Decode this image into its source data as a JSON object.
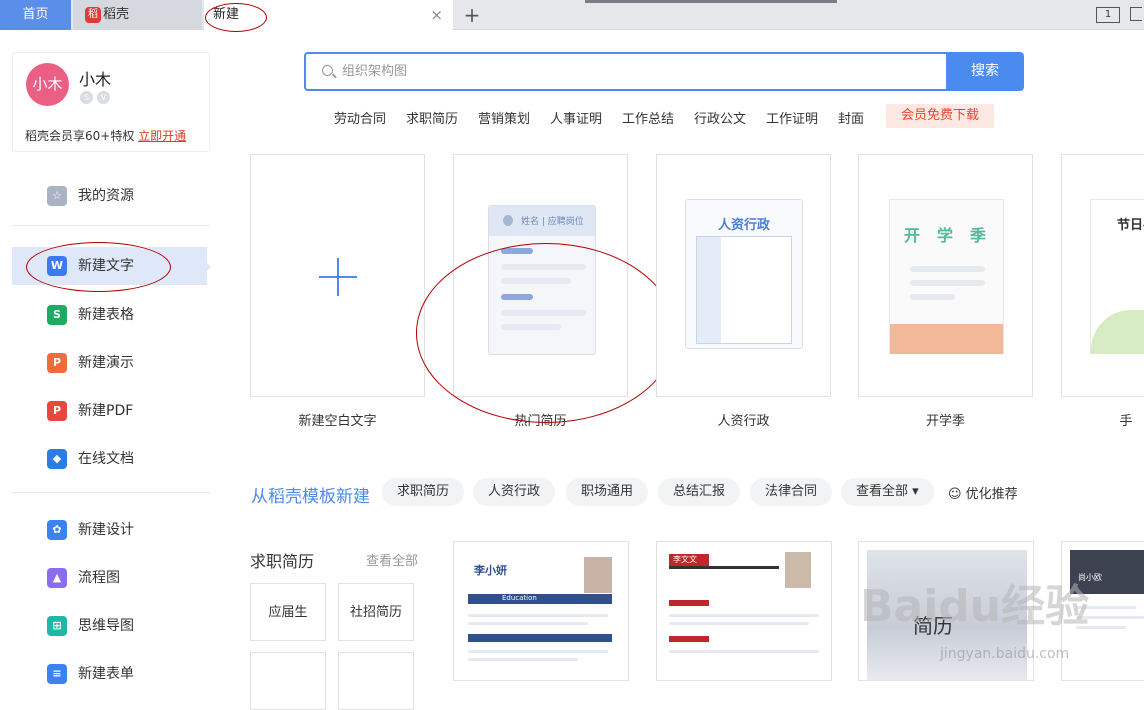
{
  "tabs": {
    "home": "首页",
    "daoke": "稻壳",
    "daoke_logo": "稻",
    "new": "新建",
    "close": "×",
    "plus": "+"
  },
  "layout_icon": "1",
  "user": {
    "avatar": "小木",
    "name": "小木",
    "vip_text": "稻壳会员享60+特权",
    "vip_link": "立即开通"
  },
  "sidebar": {
    "items": [
      {
        "label": "我的资源",
        "icon": "☆"
      },
      {
        "label": "新建文字",
        "icon": "W"
      },
      {
        "label": "新建表格",
        "icon": "S"
      },
      {
        "label": "新建演示",
        "icon": "P"
      },
      {
        "label": "新建PDF",
        "icon": "P"
      },
      {
        "label": "在线文档",
        "icon": "◆"
      },
      {
        "label": "新建设计",
        "icon": "✿"
      },
      {
        "label": "流程图",
        "icon": "▲"
      },
      {
        "label": "思维导图",
        "icon": "⊞"
      },
      {
        "label": "新建表单",
        "icon": "≡"
      }
    ]
  },
  "search": {
    "placeholder": "组织架构图",
    "button": "搜索"
  },
  "hot_tags": [
    "劳动合同",
    "求职简历",
    "营销策划",
    "人事证明",
    "工作总结",
    "行政公文",
    "工作证明",
    "封面"
  ],
  "hot_vip": "会员免费下载",
  "cards": [
    {
      "label": "新建空白文字"
    },
    {
      "label": "热门简历",
      "field": "姓名 | 应聘岗位"
    },
    {
      "label": "人资行政",
      "title": "人资行政"
    },
    {
      "label": "开学季",
      "chars": [
        "开",
        "学",
        "季"
      ]
    },
    {
      "label": "手",
      "title": "节日手"
    }
  ],
  "template_section": {
    "title": "从稻壳模板新建",
    "chips": [
      "求职简历",
      "人资行政",
      "职场通用",
      "总结汇报",
      "法律合同",
      "查看全部 ▾"
    ],
    "optimize": "☺ 优化推荐"
  },
  "category": {
    "title": "求职简历",
    "view_all": "查看全部",
    "subs": [
      "应届生",
      "社招简历"
    ]
  },
  "templates": [
    {
      "name": "李小妍",
      "tag": "Education"
    },
    {
      "name": "李文文"
    },
    {
      "name": "简历"
    },
    {
      "name": "尚小欧"
    }
  ],
  "watermark": {
    "main": "Baidu经验",
    "sub": "jingyan.baidu.com"
  }
}
